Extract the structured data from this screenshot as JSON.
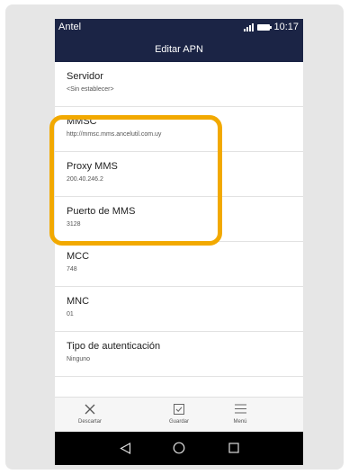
{
  "status_bar": {
    "carrier": "Antel",
    "time": "10:17"
  },
  "header": {
    "title": "Editar APN"
  },
  "settings": [
    {
      "label": "Servidor",
      "value": "<Sin establecer>"
    },
    {
      "label": "MMSC",
      "value": "http://mmsc.mms.ancelutil.com.uy"
    },
    {
      "label": "Proxy MMS",
      "value": "200.40.246.2"
    },
    {
      "label": "Puerto de MMS",
      "value": "3128"
    },
    {
      "label": "MCC",
      "value": "748"
    },
    {
      "label": "MNC",
      "value": "01"
    },
    {
      "label": "Tipo de autenticación",
      "value": "Ninguno"
    }
  ],
  "toolbar": {
    "discard": "Descartar",
    "save": "Guardar",
    "menu": "Menú"
  },
  "icons": {
    "discard": "close-icon",
    "save": "checkbox-icon",
    "menu": "menu-icon",
    "back": "back-triangle-icon",
    "home": "home-circle-icon",
    "recents": "recents-square-icon"
  },
  "colors": {
    "header": "#1b2445",
    "highlight": "#f2a900"
  }
}
